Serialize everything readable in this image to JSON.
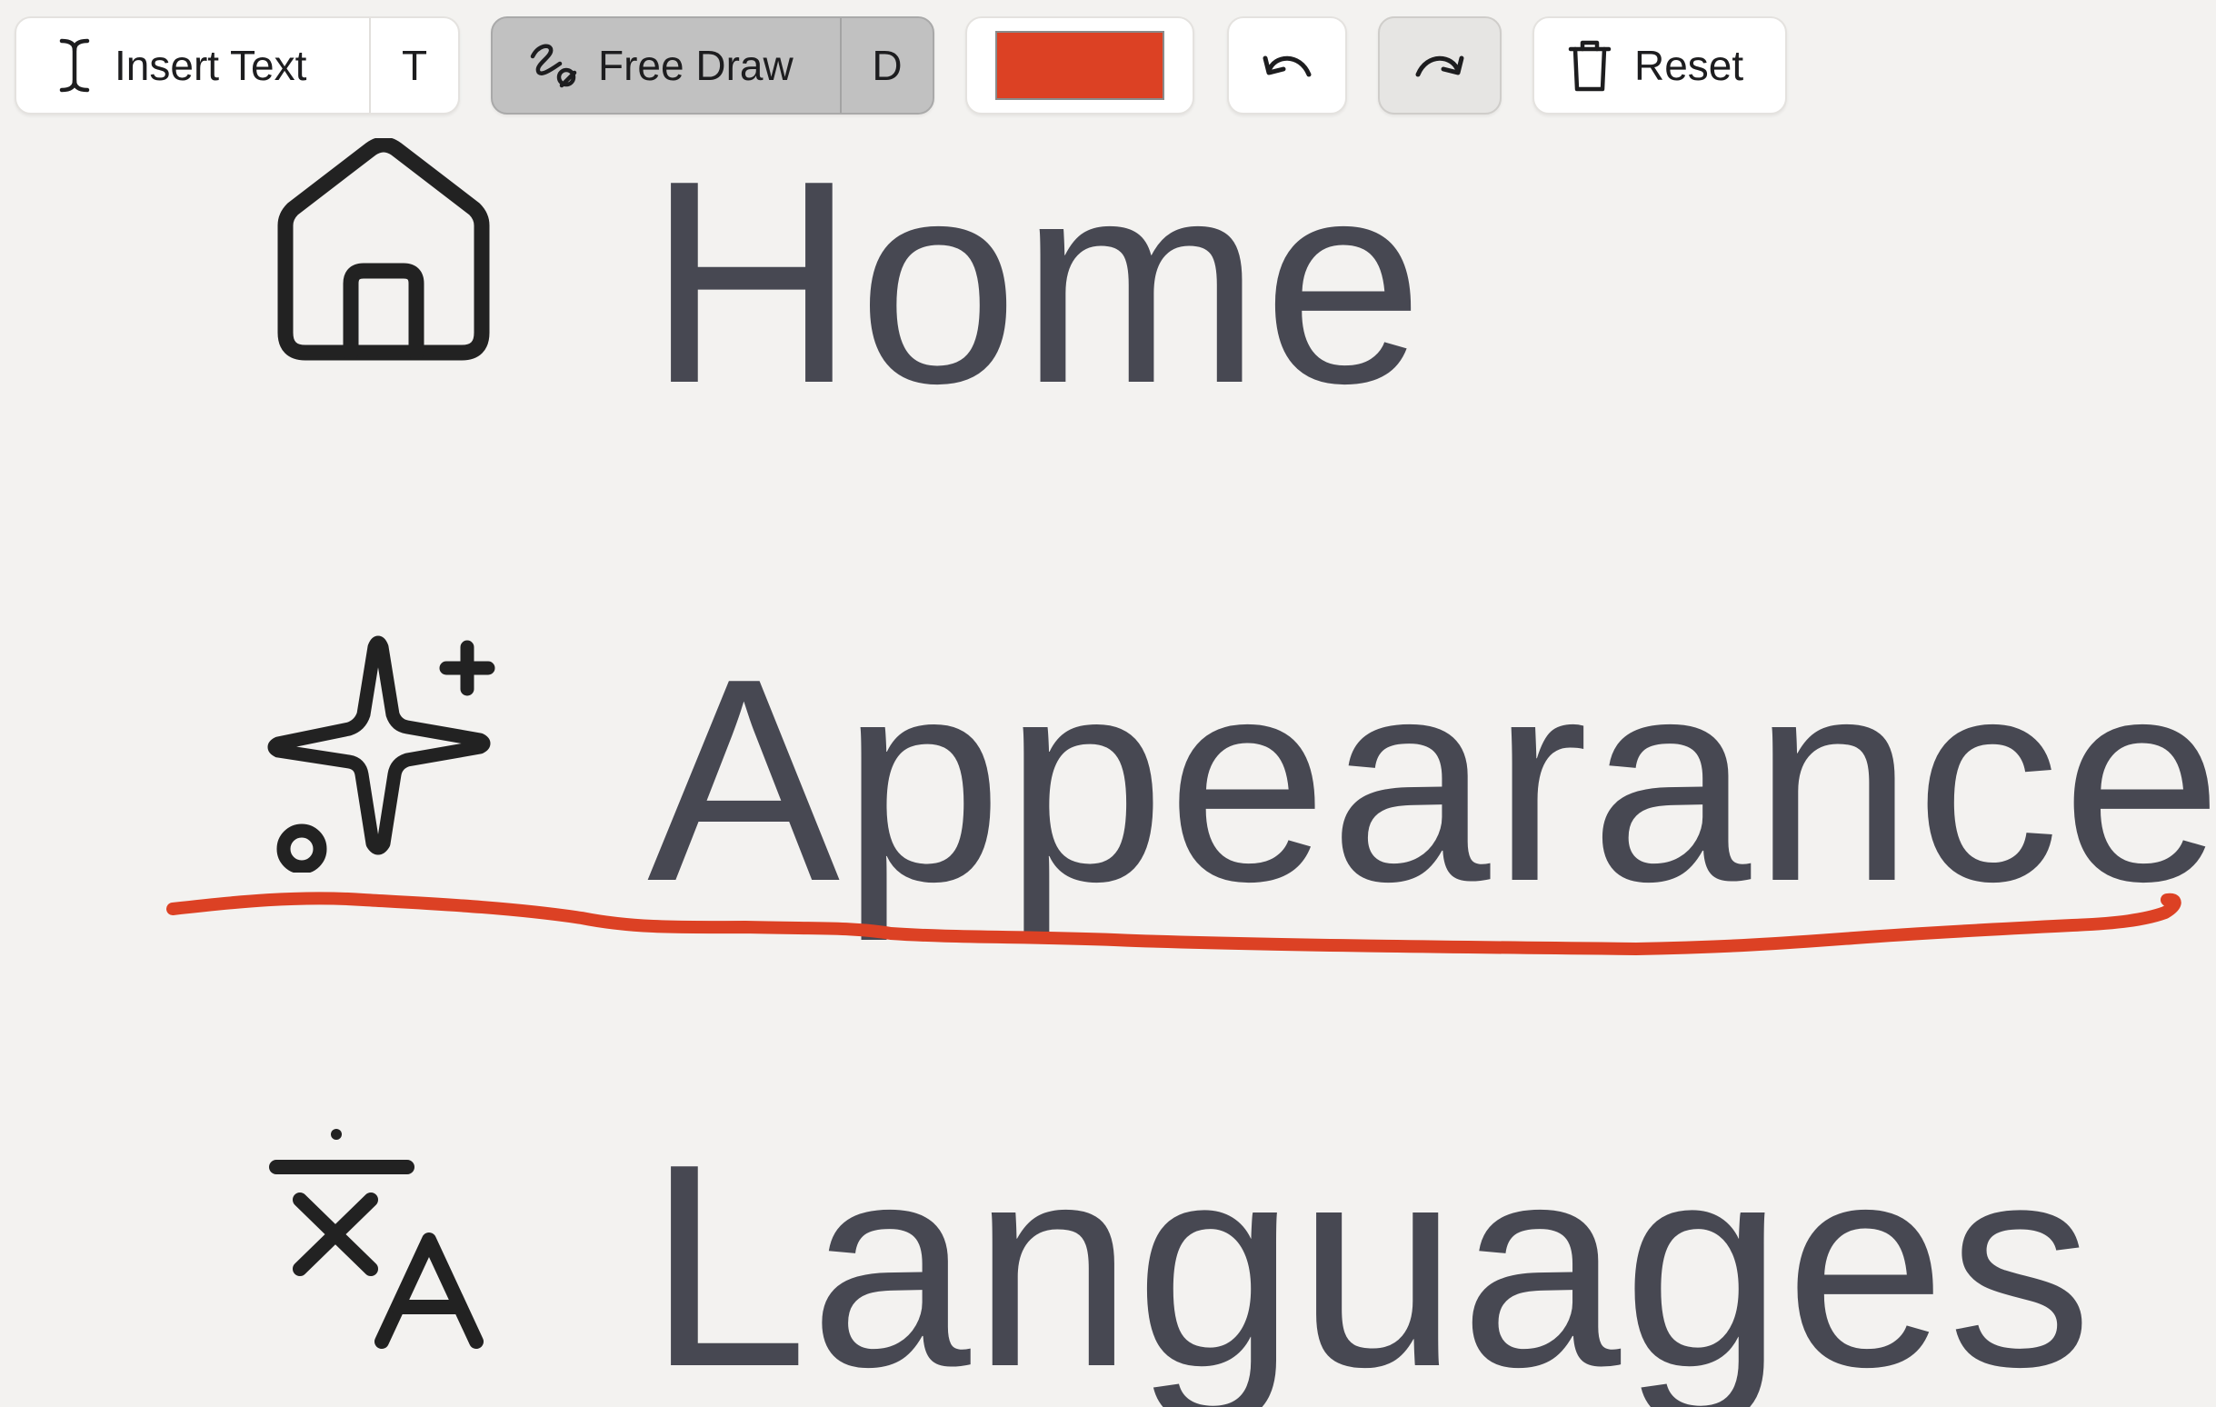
{
  "toolbar": {
    "insert_text": {
      "label": "Insert Text",
      "shortcut": "T",
      "icon": "text-cursor-icon"
    },
    "free_draw": {
      "label": "Free Draw",
      "shortcut": "D",
      "icon": "squiggle-pen-icon",
      "active": true
    },
    "color": {
      "value": "#dc4124",
      "icon": "color-swatch"
    },
    "undo": {
      "icon": "undo-arrow-icon"
    },
    "redo": {
      "icon": "redo-arrow-icon"
    },
    "reset": {
      "label": "Reset",
      "icon": "trash-icon"
    }
  },
  "menu": {
    "items": [
      {
        "label": "Home",
        "icon": "house-icon"
      },
      {
        "label": "Appearance",
        "icon": "sparkle-icon"
      },
      {
        "label": "Languages",
        "icon": "translate-icon"
      }
    ]
  },
  "colors": {
    "background": "#f3f2f0",
    "label_text": "#474852",
    "icon_stroke": "#222222",
    "active_tool_bg": "#c1c1c1",
    "annotation_stroke": "#dc4124"
  },
  "annotation": {
    "type": "freehand-underline",
    "target": "Appearance",
    "color": "#dc4124"
  }
}
